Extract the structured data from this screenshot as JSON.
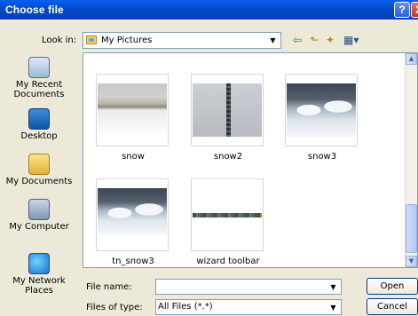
{
  "window": {
    "title": "Choose file",
    "help_glyph": "?",
    "close_glyph": "X"
  },
  "lookin": {
    "label": "Look in:",
    "value": "My Pictures",
    "arrow": "▼"
  },
  "toolbar": {
    "back_glyph": "⇦",
    "up_glyph": "⬑",
    "newfolder_glyph": "✦",
    "views_glyph": "▦▾"
  },
  "places": {
    "items": [
      {
        "label_line1": "My Recent",
        "label_line2": "Documents",
        "icon": "recent-documents-icon"
      },
      {
        "label_line1": "Desktop",
        "label_line2": "",
        "icon": "desktop-icon"
      },
      {
        "label_line1": "My Documents",
        "label_line2": "",
        "icon": "my-documents-icon"
      },
      {
        "label_line1": "My Computer",
        "label_line2": "",
        "icon": "my-computer-icon"
      },
      {
        "label_line1": "My Network",
        "label_line2": "Places",
        "icon": "network-places-icon"
      }
    ]
  },
  "files": {
    "items": [
      {
        "name": "snow"
      },
      {
        "name": "snow2"
      },
      {
        "name": "snow3"
      },
      {
        "name": "tn_snow3"
      },
      {
        "name": "wizard toolbar"
      }
    ]
  },
  "scrollbar": {
    "up_glyph": "▲",
    "down_glyph": "▼"
  },
  "filename": {
    "label": "File name:",
    "value": "",
    "placeholder": "",
    "arrow": "▼"
  },
  "filetype": {
    "label": "Files of type:",
    "value": "All Files (*.*)",
    "arrow": "▼"
  },
  "buttons": {
    "open_label": "Open",
    "cancel_label": "Cancel"
  }
}
